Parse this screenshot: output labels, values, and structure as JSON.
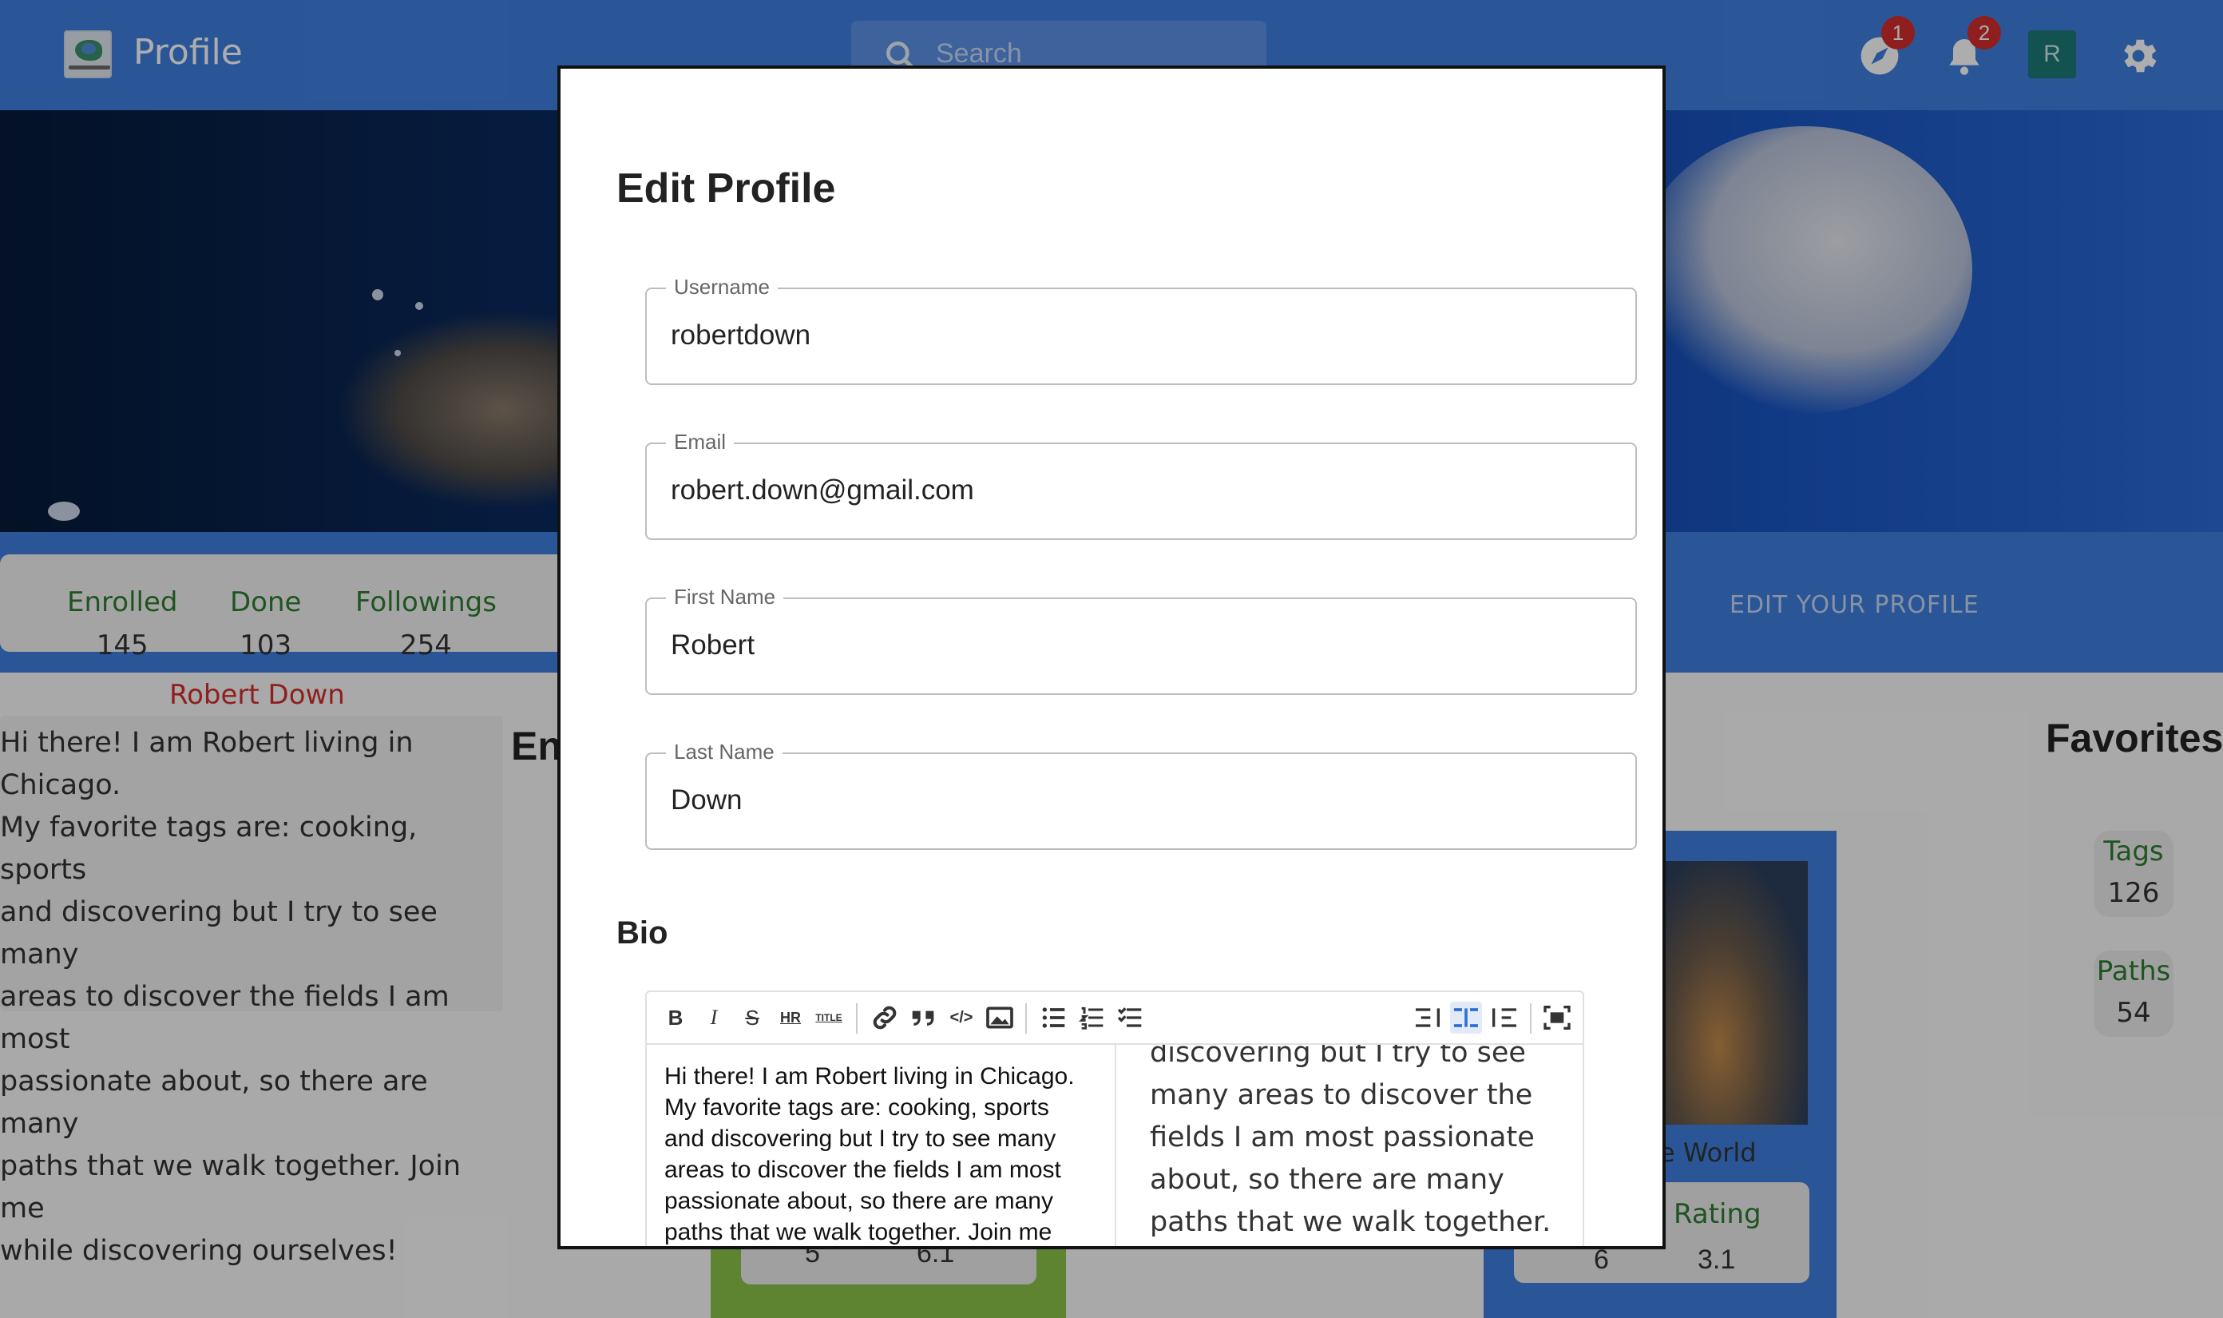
{
  "app": {
    "title": "Profile"
  },
  "search": {
    "placeholder": "Search"
  },
  "topbar": {
    "badges": {
      "compass": "1",
      "notifications": "2"
    },
    "avatar_initial": "R"
  },
  "stats": [
    {
      "label": "Enrolled",
      "value": "145"
    },
    {
      "label": "Done",
      "value": "103"
    },
    {
      "label": "Followings",
      "value": "254"
    }
  ],
  "edit_profile_link": "EDIT YOUR PROFILE",
  "profile": {
    "name": "Robert Down",
    "bio_lines": [
      "Hi there! I am Robert living in Chicago.",
      "My favorite tags are: cooking, sports",
      "and discovering but I try to see many",
      "areas to discover the fields I am most",
      "passionate about, so there are many",
      "paths that we walk together. Join me",
      "while discovering ourselves!"
    ]
  },
  "sections": {
    "enrolled_partial": "En",
    "favorites": "Favorites"
  },
  "favorites": [
    {
      "label": "Tags",
      "value": "126"
    },
    {
      "label": "Paths",
      "value": "54"
    }
  ],
  "behind_cards": {
    "green_values": [
      "5",
      "6.1"
    ],
    "blue": {
      "title_partial": "e World",
      "rating_label": "Rating",
      "values": [
        "6",
        "3.1"
      ]
    }
  },
  "modal": {
    "title": "Edit Profile",
    "fields": [
      {
        "label": "Username",
        "value": "robertdown"
      },
      {
        "label": "Email",
        "value": "robert.down@gmail.com"
      },
      {
        "label": "First Name",
        "value": "Robert"
      },
      {
        "label": "Last Name",
        "value": "Down"
      }
    ],
    "bio_heading": "Bio",
    "editor": {
      "toolbar": [
        "B",
        "I",
        "S",
        "HR",
        "TITLE",
        "link",
        "quote",
        "</>",
        "image",
        "ul",
        "ol",
        "tasks",
        "side-left",
        "side-both",
        "side-right",
        "fullscreen"
      ],
      "source_lines": [
        "Hi there! I am Robert living in Chicago.",
        "My favorite tags are: cooking, sports",
        "and discovering but I try to see many",
        "areas to discover the fields I am most",
        "passionate about, so there are many",
        "paths that we walk together. Join me"
      ],
      "preview_lines": [
        "discovering but I try to see",
        "many areas to discover the",
        "fields I am most passionate",
        "about, so there are many",
        "paths that we walk together."
      ]
    }
  },
  "colors": {
    "primary": "#3f7fe0",
    "accent_green": "#2e7d32",
    "name_red": "#d32f2f"
  }
}
